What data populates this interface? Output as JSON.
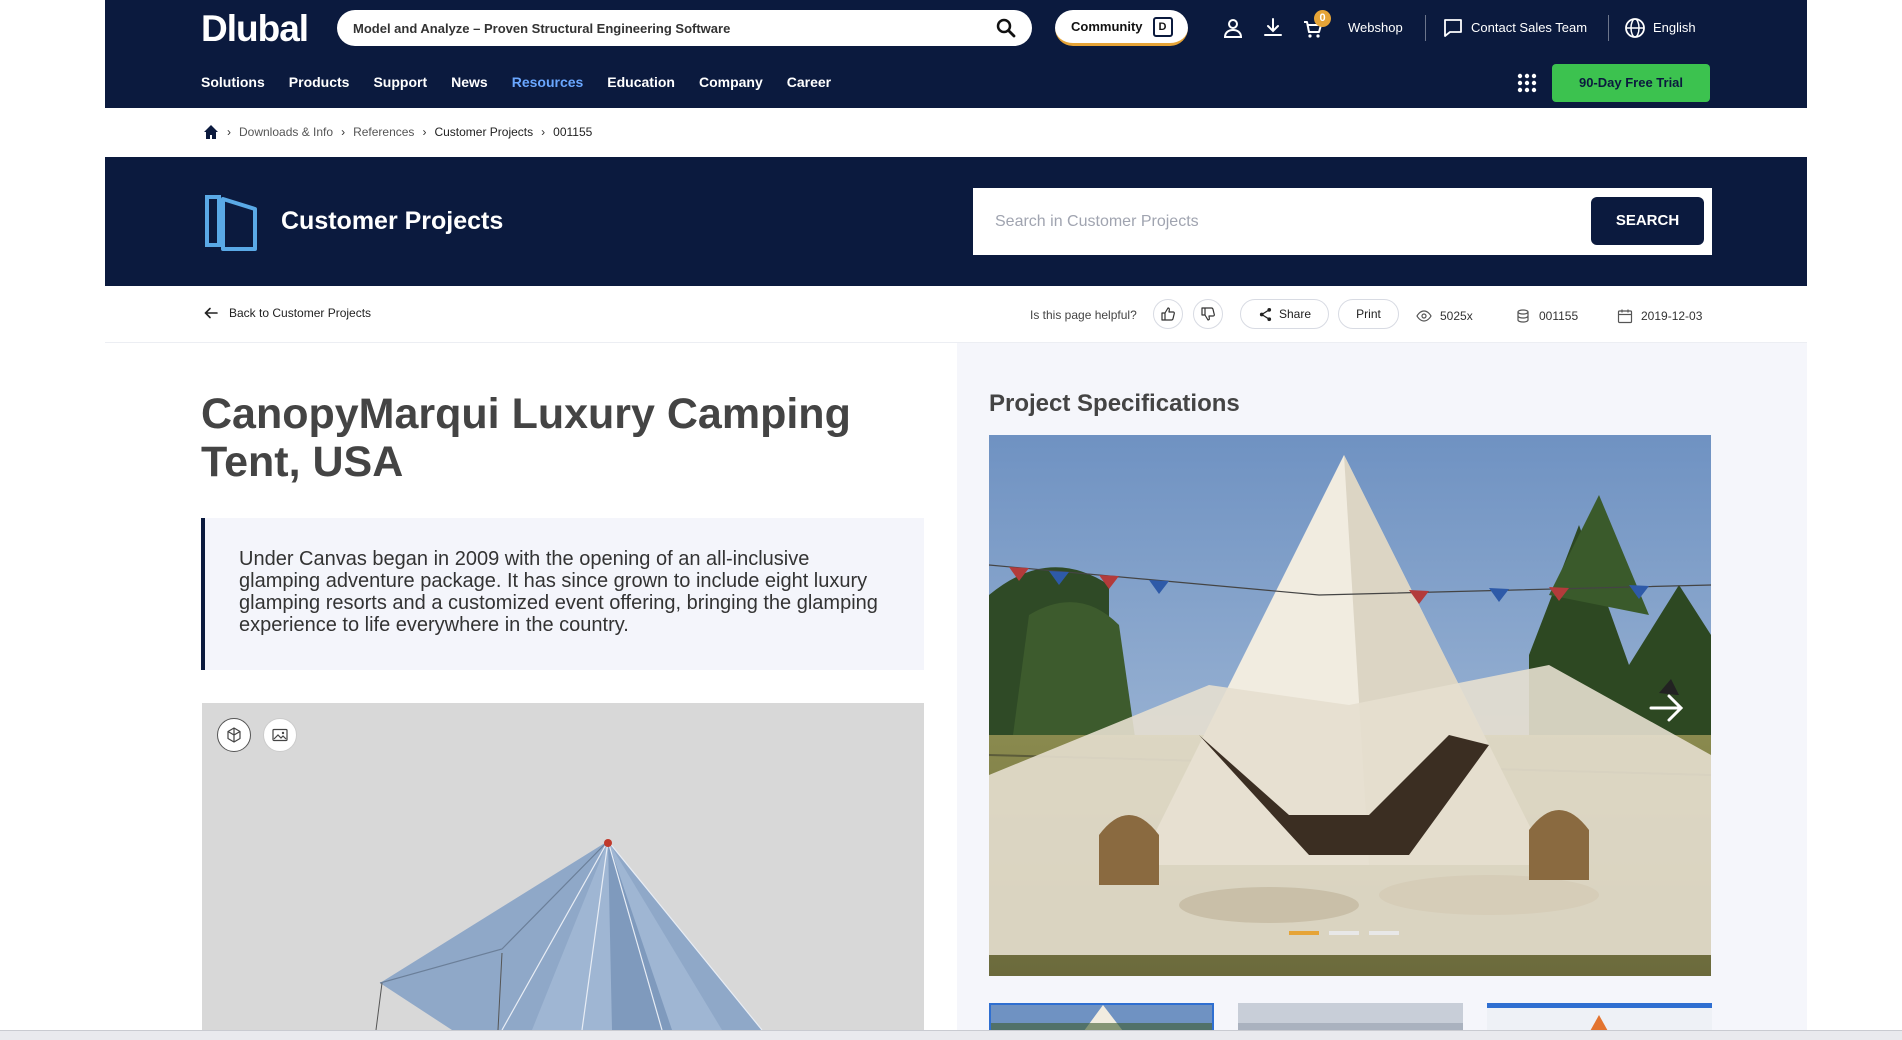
{
  "header": {
    "logo": "Dlubal",
    "search_placeholder": "Model and Analyze – Proven Structural Engineering Software",
    "community_label": "Community",
    "community_icon_text": "D",
    "cart_count": "0",
    "webshop": "Webshop",
    "contact": "Contact Sales Team",
    "language": "English",
    "trial": "90-Day Free Trial"
  },
  "nav": [
    "Solutions",
    "Products",
    "Support",
    "News",
    "Resources",
    "Education",
    "Company",
    "Career"
  ],
  "breadcrumb": [
    "Downloads & Info",
    "References",
    "Customer Projects",
    "001155"
  ],
  "banner": {
    "title": "Customer Projects",
    "search_placeholder": "Search in Customer Projects",
    "search_button": "SEARCH"
  },
  "toolbar": {
    "back": "Back to Customer Projects",
    "helpful": "Is this page helpful?",
    "share": "Share",
    "print": "Print",
    "views": "5025x",
    "id": "001155",
    "date": "2019-12-03"
  },
  "project": {
    "title": "CanopyMarqui Luxury Camping Tent, USA",
    "summary": "Under Canvas began in 2009 with the opening of an all-inclusive glamping adventure package. It has since grown to include eight luxury glamping resorts and a customized event offering, bringing the glamping experience to life everywhere in the country."
  },
  "specs": {
    "title": "Project Specifications"
  },
  "colors": {
    "navy": "#0b1a3e",
    "accent_green": "#3cc24f",
    "accent_orange": "#e6a437",
    "nav_active": "#6aa7ff"
  }
}
